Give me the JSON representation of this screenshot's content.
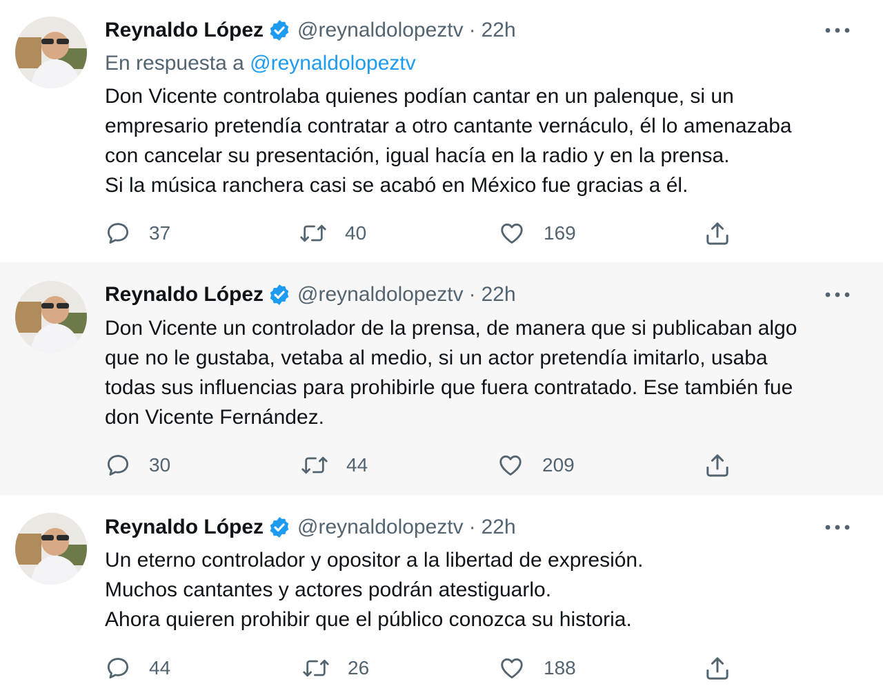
{
  "tweets": [
    {
      "author": {
        "name": "Reynaldo López",
        "handle": "@reynaldolopeztv"
      },
      "separator": "·",
      "time": "22h",
      "reply_to": {
        "prefix": "En respuesta a",
        "mention": "@reynaldolopeztv"
      },
      "lines": [
        "Don Vicente controlaba quienes podían cantar en un palenque, si un",
        "empresario pretendía contratar a otro cantante vernáculo, él lo amenazaba",
        "con cancelar su presentación, igual hacía en la radio y en la prensa.",
        "Si la música ranchera casi se acabó en México fue gracias a él."
      ],
      "stats": {
        "replies": "37",
        "retweets": "40",
        "likes": "169"
      }
    },
    {
      "author": {
        "name": "Reynaldo López",
        "handle": "@reynaldolopeztv"
      },
      "separator": "·",
      "time": "22h",
      "lines": [
        "Don Vicente un controlador de la prensa, de manera que si publicaban algo",
        "que no le gustaba, vetaba al medio, si un actor pretendía imitarlo, usaba",
        "todas sus influencias para prohibirle que fuera contratado. Ese también fue",
        "don Vicente Fernández."
      ],
      "stats": {
        "replies": "30",
        "retweets": "44",
        "likes": "209"
      }
    },
    {
      "author": {
        "name": "Reynaldo López",
        "handle": "@reynaldolopeztv"
      },
      "separator": "·",
      "time": "22h",
      "lines": [
        "Un eterno controlador y opositor a la libertad de expresión.",
        "Muchos cantantes y actores podrán atestiguarlo.",
        "Ahora quieren prohibir que el público conozca su historia."
      ],
      "stats": {
        "replies": "44",
        "retweets": "26",
        "likes": "188"
      }
    }
  ],
  "icons": {
    "verified": "verified-badge-icon",
    "more": "more-options-icon",
    "reply": "reply-icon",
    "retweet": "retweet-icon",
    "like": "like-icon",
    "share": "share-icon"
  },
  "colors": {
    "text": "#0f1419",
    "secondary": "#536471",
    "accent": "#1d9bf0",
    "thread_line": "#cfd9de",
    "highlight_bg": "#f7f7f7"
  }
}
